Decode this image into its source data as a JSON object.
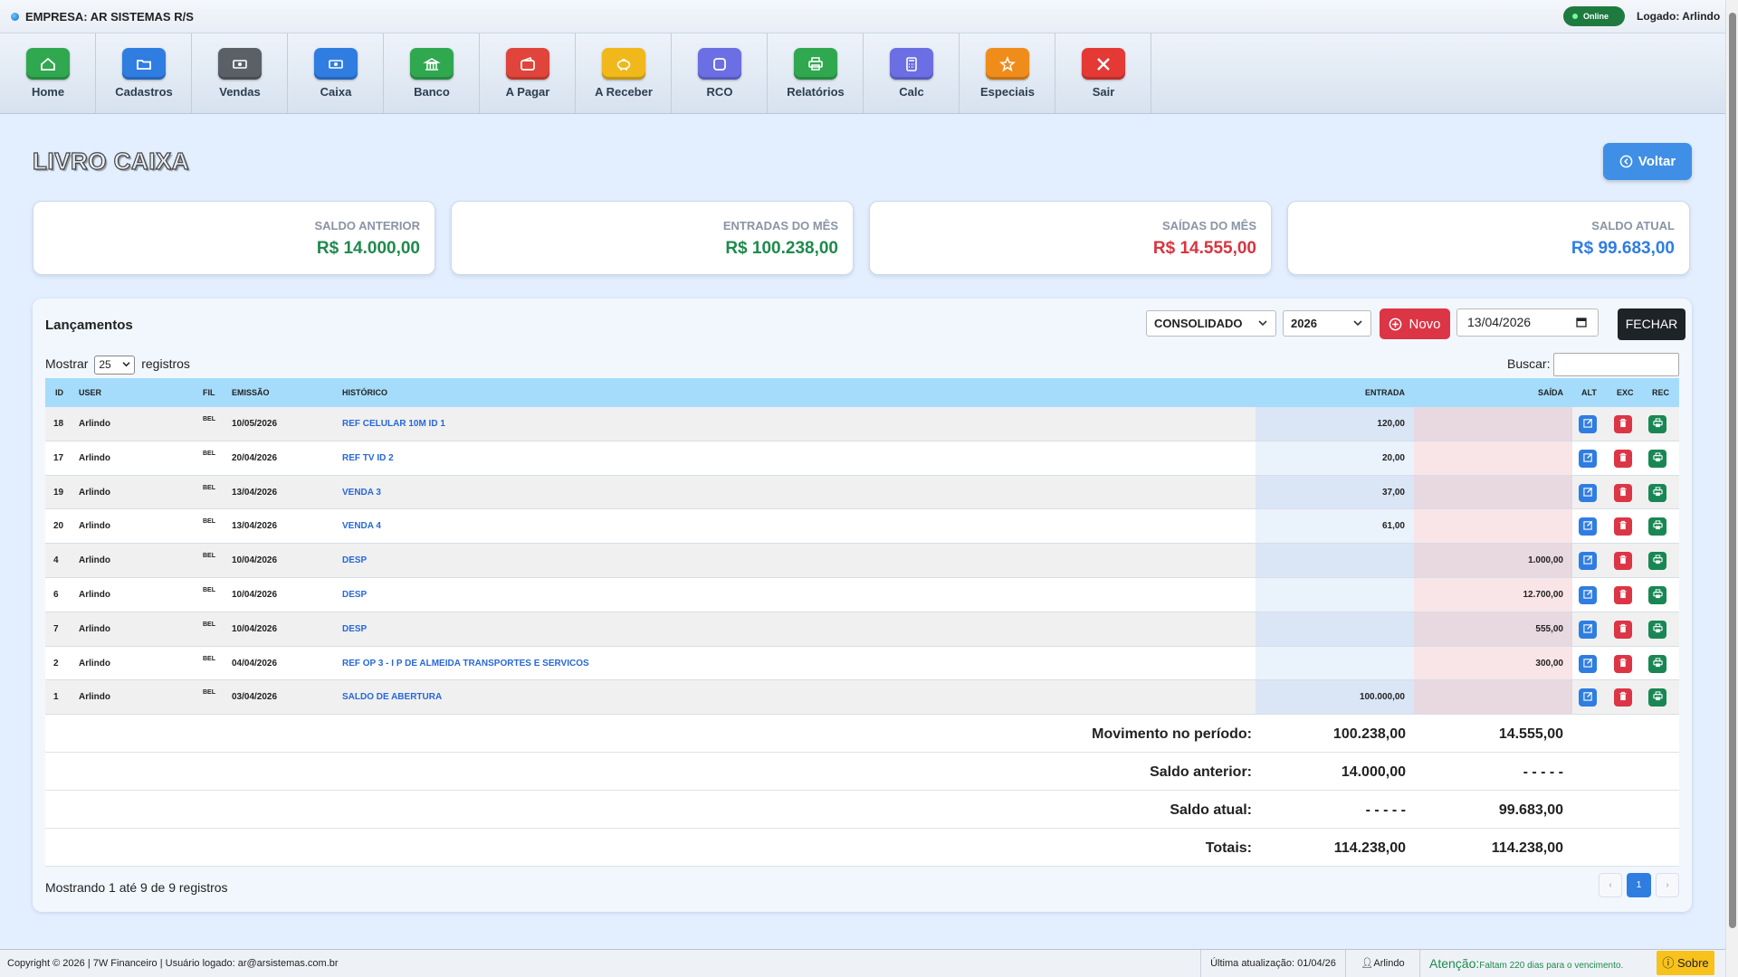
{
  "topbar": {
    "company": "EMPRESA: AR SISTEMAS R/S",
    "status": "Online",
    "logged": "Logado: Arlindo"
  },
  "nav": [
    {
      "label": "Home",
      "icon": "home-icon",
      "color": "#2fa84f"
    },
    {
      "label": "Cadastros",
      "icon": "folder-icon",
      "color": "#2f7de1"
    },
    {
      "label": "Vendas",
      "icon": "cash-icon",
      "color": "#5a6068"
    },
    {
      "label": "Caixa",
      "icon": "cash-register-icon",
      "color": "#2f7de1"
    },
    {
      "label": "Banco",
      "icon": "bank-icon",
      "color": "#2fa84f"
    },
    {
      "label": "A Pagar",
      "icon": "wallet-icon",
      "color": "#e0443a"
    },
    {
      "label": "A Receber",
      "icon": "piggy-bank-icon",
      "color": "#f0b81a"
    },
    {
      "label": "RCO",
      "icon": "square-icon",
      "color": "#6b6fe3"
    },
    {
      "label": "Relatórios",
      "icon": "printer-icon",
      "color": "#2fa84f"
    },
    {
      "label": "Calc",
      "icon": "calculator-icon",
      "color": "#6b6fe3"
    },
    {
      "label": "Especiais",
      "icon": "star-icon",
      "color": "#f08c1a"
    },
    {
      "label": "Sair",
      "icon": "close-icon",
      "color": "#e53935"
    }
  ],
  "page": {
    "title": "LIVRO CAIXA",
    "back_label": "Voltar"
  },
  "cards": [
    {
      "label": "SALDO ANTERIOR",
      "value": "R$ 14.000,00",
      "color": "#1f8a4c"
    },
    {
      "label": "ENTRADAS DO MÊS",
      "value": "R$ 100.238,00",
      "color": "#1f8a4c"
    },
    {
      "label": "SAÍDAS DO MÊS",
      "value": "R$ 14.555,00",
      "color": "#d9343f"
    },
    {
      "label": "SALDO ATUAL",
      "value": "R$ 99.683,00",
      "color": "#2f7de1"
    }
  ],
  "panel": {
    "title": "Lançamentos",
    "filter": "CONSOLIDADO",
    "year": "2026",
    "new_label": "Novo",
    "date": "13/04/2026",
    "close_label": "FECHAR",
    "show_prefix": "Mostrar",
    "show_value": "25",
    "show_suffix": "registros",
    "search_label": "Buscar:",
    "search_value": "",
    "showing": "Mostrando 1 até 9 de 9 registros",
    "page_prev": "‹",
    "page_current": "1",
    "page_next": "›"
  },
  "columns": {
    "id": "ID",
    "user": "USER",
    "fil": "FIL",
    "emissao": "EMISSÃO",
    "historico": "HISTÓRICO",
    "entrada": "ENTRADA",
    "saida": "SAÍDA",
    "alt": "ALT",
    "exc": "EXC",
    "rec": "REC"
  },
  "rows": [
    {
      "id": "18",
      "user": "Arlindo",
      "fil": "BEL",
      "emissao": "10/05/2026",
      "historico": "REF CELULAR 10M ID 1",
      "entrada": "120,00",
      "saida": ""
    },
    {
      "id": "17",
      "user": "Arlindo",
      "fil": "BEL",
      "emissao": "20/04/2026",
      "historico": "REF TV ID 2",
      "entrada": "20,00",
      "saida": ""
    },
    {
      "id": "19",
      "user": "Arlindo",
      "fil": "BEL",
      "emissao": "13/04/2026",
      "historico": "VENDA 3",
      "entrada": "37,00",
      "saida": ""
    },
    {
      "id": "20",
      "user": "Arlindo",
      "fil": "BEL",
      "emissao": "13/04/2026",
      "historico": "VENDA 4",
      "entrada": "61,00",
      "saida": ""
    },
    {
      "id": "4",
      "user": "Arlindo",
      "fil": "BEL",
      "emissao": "10/04/2026",
      "historico": "DESP",
      "entrada": "",
      "saida": "1.000,00"
    },
    {
      "id": "6",
      "user": "Arlindo",
      "fil": "BEL",
      "emissao": "10/04/2026",
      "historico": "DESP",
      "entrada": "",
      "saida": "12.700,00"
    },
    {
      "id": "7",
      "user": "Arlindo",
      "fil": "BEL",
      "emissao": "10/04/2026",
      "historico": "DESP",
      "entrada": "",
      "saida": "555,00"
    },
    {
      "id": "2",
      "user": "Arlindo",
      "fil": "BEL",
      "emissao": "04/04/2026",
      "historico": "REF OP 3 - I P DE ALMEIDA TRANSPORTES E SERVICOS",
      "entrada": "",
      "saida": "300,00"
    },
    {
      "id": "1",
      "user": "Arlindo",
      "fil": "BEL",
      "emissao": "03/04/2026",
      "historico": "SALDO DE ABERTURA",
      "entrada": "100.000,00",
      "saida": ""
    }
  ],
  "summary": [
    {
      "label": "Movimento no período:",
      "entrada": "100.238,00",
      "saida": "14.555,00"
    },
    {
      "label": "Saldo anterior:",
      "entrada": "14.000,00",
      "saida": "- - - - -"
    },
    {
      "label": "Saldo atual:",
      "entrada": "- - - - -",
      "saida": "99.683,00"
    },
    {
      "label": "Totais:",
      "entrada": "114.238,00",
      "saida": "114.238,00"
    }
  ],
  "footer": {
    "copyright": "Copyright © 2026 | 7W Financeiro | Usuário logado: ar@arsistemas.com.br",
    "updated": "Última atualização: 01/04/26",
    "user": "Arlindo",
    "attention_label": "Atenção:",
    "attention_text": "Faltam 220 dias para o vencimento.",
    "about": "Sobre"
  }
}
